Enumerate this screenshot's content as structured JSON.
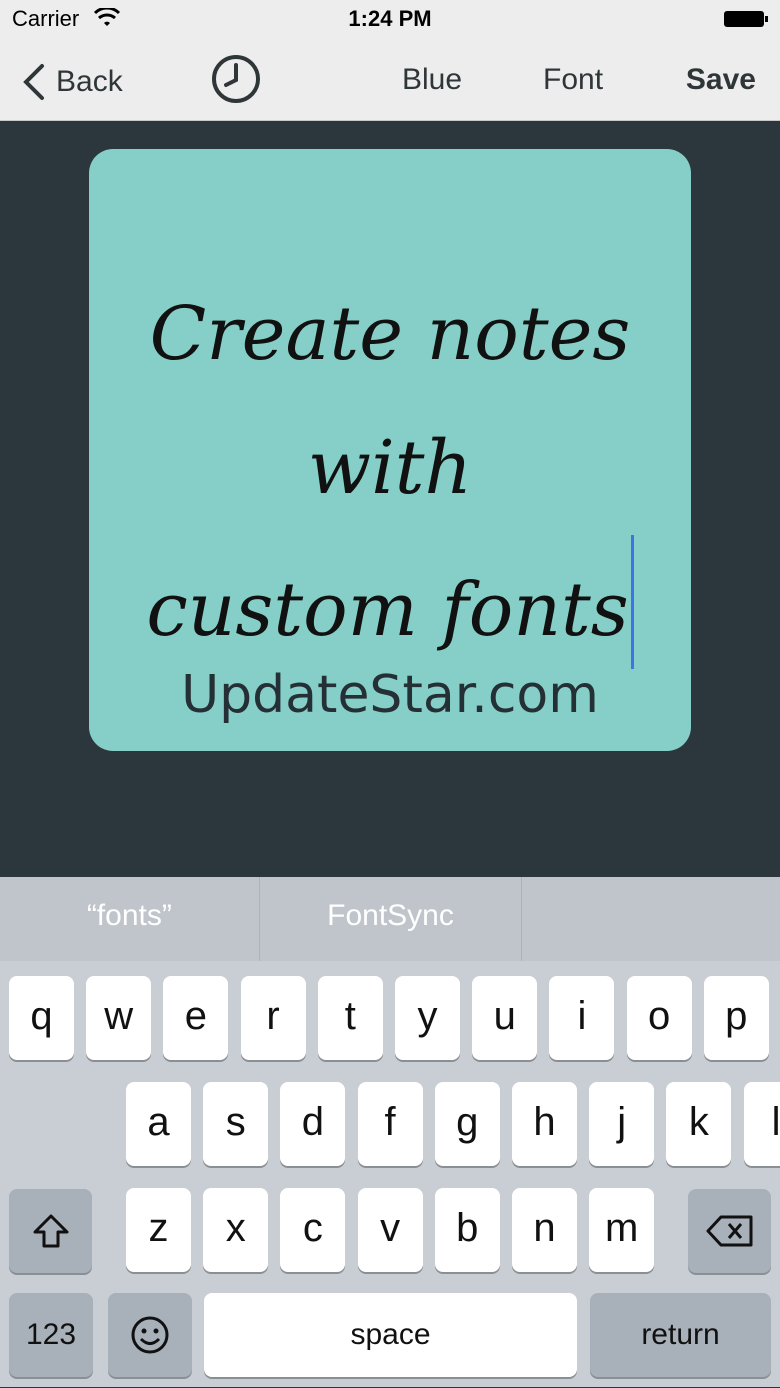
{
  "status_bar": {
    "carrier": "Carrier",
    "time": "1:24 PM"
  },
  "nav": {
    "back": "Back",
    "blue": "Blue",
    "font": "Font",
    "save": "Save"
  },
  "note": {
    "line1": "Create notes with",
    "line2": "custom fonts"
  },
  "watermark": "UpdateStar.com",
  "suggestions": [
    "“fonts”",
    "FontSync",
    ""
  ],
  "keyboard": {
    "row1": [
      "q",
      "w",
      "e",
      "r",
      "t",
      "y",
      "u",
      "i",
      "o",
      "p"
    ],
    "row2": [
      "a",
      "s",
      "d",
      "f",
      "g",
      "h",
      "j",
      "k",
      "l"
    ],
    "row3": [
      "z",
      "x",
      "c",
      "v",
      "b",
      "n",
      "m"
    ],
    "numbers": "123",
    "space": "space",
    "return": "return"
  },
  "colors": {
    "card": "#85cfc8",
    "background": "#2c373d",
    "cursor": "#3f74e8"
  },
  "icons": [
    "chevron-left-icon",
    "clock-icon",
    "shift-icon",
    "delete-icon",
    "emoji-icon",
    "wifi-icon",
    "battery-icon"
  ]
}
